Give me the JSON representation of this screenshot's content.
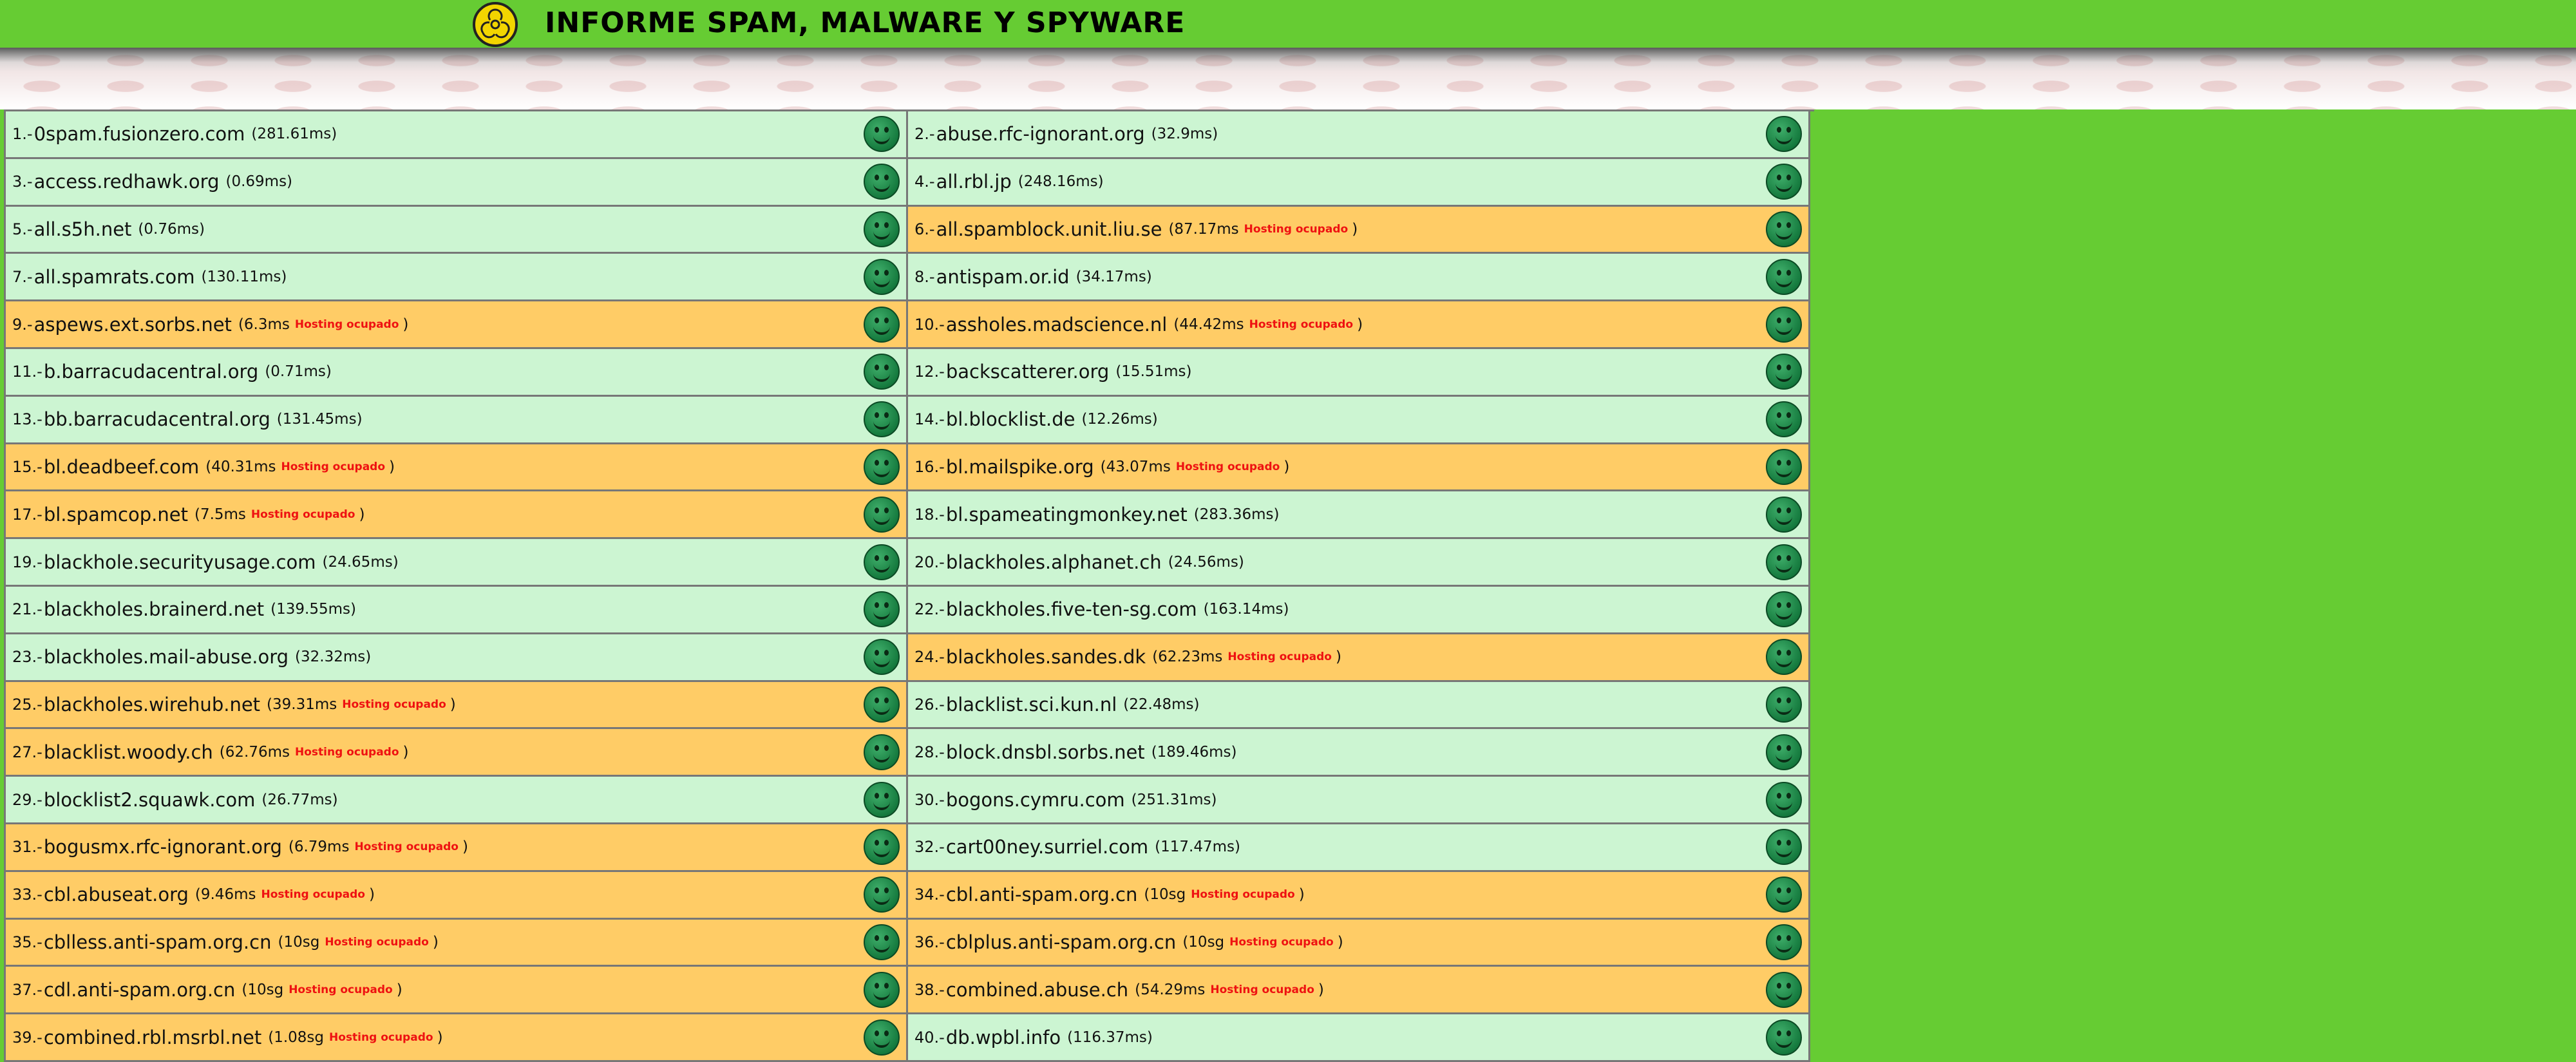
{
  "header": {
    "title": "INFORME SPAM, MALWARE Y SPYWARE",
    "icon": "biohazard-icon"
  },
  "busy_text": "Hosting ocupado",
  "rows": [
    [
      {
        "n": "1.-",
        "host": "0spam.fusionzero.com",
        "time": "(281.61ms)",
        "busy": false
      },
      {
        "n": "2.-",
        "host": "abuse.rfc-ignorant.org",
        "time": "(32.9ms)",
        "busy": false
      }
    ],
    [
      {
        "n": "3.-",
        "host": "access.redhawk.org",
        "time": "(0.69ms)",
        "busy": false
      },
      {
        "n": "4.-",
        "host": "all.rbl.jp",
        "time": "(248.16ms)",
        "busy": false
      }
    ],
    [
      {
        "n": "5.-",
        "host": "all.s5h.net",
        "time": "(0.76ms)",
        "busy": false
      },
      {
        "n": "6.-",
        "host": "all.spamblock.unit.liu.se",
        "time": "(87.17ms",
        "busy": true
      }
    ],
    [
      {
        "n": "7.-",
        "host": "all.spamrats.com",
        "time": "(130.11ms)",
        "busy": false
      },
      {
        "n": "8.-",
        "host": "antispam.or.id",
        "time": "(34.17ms)",
        "busy": false
      }
    ],
    [
      {
        "n": "9.-",
        "host": "aspews.ext.sorbs.net",
        "time": "(6.3ms",
        "busy": true
      },
      {
        "n": "10.-",
        "host": "assholes.madscience.nl",
        "time": "(44.42ms",
        "busy": true
      }
    ],
    [
      {
        "n": "11.-",
        "host": "b.barracudacentral.org",
        "time": "(0.71ms)",
        "busy": false
      },
      {
        "n": "12.-",
        "host": "backscatterer.org",
        "time": "(15.51ms)",
        "busy": false
      }
    ],
    [
      {
        "n": "13.-",
        "host": "bb.barracudacentral.org",
        "time": "(131.45ms)",
        "busy": false
      },
      {
        "n": "14.-",
        "host": "bl.blocklist.de",
        "time": "(12.26ms)",
        "busy": false
      }
    ],
    [
      {
        "n": "15.-",
        "host": "bl.deadbeef.com",
        "time": "(40.31ms",
        "busy": true
      },
      {
        "n": "16.-",
        "host": "bl.mailspike.org",
        "time": "(43.07ms",
        "busy": true
      }
    ],
    [
      {
        "n": "17.-",
        "host": "bl.spamcop.net",
        "time": "(7.5ms",
        "busy": true
      },
      {
        "n": "18.-",
        "host": "bl.spameatingmonkey.net",
        "time": "(283.36ms)",
        "busy": false
      }
    ],
    [
      {
        "n": "19.-",
        "host": "blackhole.securityusage.com",
        "time": "(24.65ms)",
        "busy": false
      },
      {
        "n": "20.-",
        "host": "blackholes.alphanet.ch",
        "time": "(24.56ms)",
        "busy": false
      }
    ],
    [
      {
        "n": "21.-",
        "host": "blackholes.brainerd.net",
        "time": "(139.55ms)",
        "busy": false
      },
      {
        "n": "22.-",
        "host": "blackholes.five-ten-sg.com",
        "time": "(163.14ms)",
        "busy": false
      }
    ],
    [
      {
        "n": "23.-",
        "host": "blackholes.mail-abuse.org",
        "time": "(32.32ms)",
        "busy": false
      },
      {
        "n": "24.-",
        "host": "blackholes.sandes.dk",
        "time": "(62.23ms",
        "busy": true
      }
    ],
    [
      {
        "n": "25.-",
        "host": "blackholes.wirehub.net",
        "time": "(39.31ms",
        "busy": true
      },
      {
        "n": "26.-",
        "host": "blacklist.sci.kun.nl",
        "time": "(22.48ms)",
        "busy": false
      }
    ],
    [
      {
        "n": "27.-",
        "host": "blacklist.woody.ch",
        "time": "(62.76ms",
        "busy": true
      },
      {
        "n": "28.-",
        "host": "block.dnsbl.sorbs.net",
        "time": "(189.46ms)",
        "busy": false
      }
    ],
    [
      {
        "n": "29.-",
        "host": "blocklist2.squawk.com",
        "time": "(26.77ms)",
        "busy": false
      },
      {
        "n": "30.-",
        "host": "bogons.cymru.com",
        "time": "(251.31ms)",
        "busy": false
      }
    ],
    [
      {
        "n": "31.-",
        "host": "bogusmx.rfc-ignorant.org",
        "time": "(6.79ms",
        "busy": true
      },
      {
        "n": "32.-",
        "host": "cart00ney.surriel.com",
        "time": "(117.47ms)",
        "busy": false
      }
    ],
    [
      {
        "n": "33.-",
        "host": "cbl.abuseat.org",
        "time": "(9.46ms",
        "busy": true
      },
      {
        "n": "34.-",
        "host": "cbl.anti-spam.org.cn",
        "time": "(10sg",
        "busy": true
      }
    ],
    [
      {
        "n": "35.-",
        "host": "cblless.anti-spam.org.cn",
        "time": "(10sg",
        "busy": true
      },
      {
        "n": "36.-",
        "host": "cblplus.anti-spam.org.cn",
        "time": "(10sg",
        "busy": true
      }
    ],
    [
      {
        "n": "37.-",
        "host": "cdl.anti-spam.org.cn",
        "time": "(10sg",
        "busy": true
      },
      {
        "n": "38.-",
        "host": "combined.abuse.ch",
        "time": "(54.29ms",
        "busy": true
      }
    ],
    [
      {
        "n": "39.-",
        "host": "combined.rbl.msrbl.net",
        "time": "(1.08sg",
        "busy": true
      },
      {
        "n": "40.-",
        "host": "db.wpbl.info",
        "time": "(116.37ms)",
        "busy": false
      }
    ]
  ]
}
